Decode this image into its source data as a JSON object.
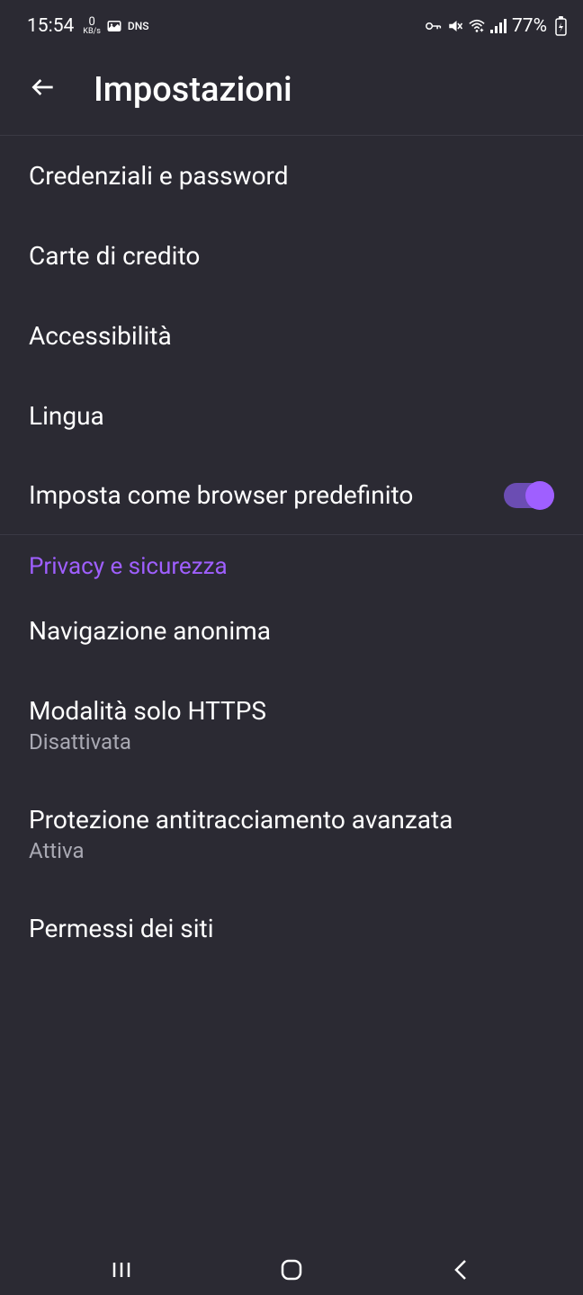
{
  "statusBar": {
    "time": "15:54",
    "speedNum": "0",
    "speedUnit": "KB/s",
    "dns": "DNS",
    "battery": "77%"
  },
  "header": {
    "title": "Impostazioni"
  },
  "settings": {
    "credentials": "Credenziali e password",
    "cards": "Carte di credito",
    "accessibility": "Accessibilità",
    "language": "Lingua",
    "defaultBrowser": "Imposta come browser predefinito"
  },
  "privacy": {
    "sectionTitle": "Privacy e sicurezza",
    "privateBrowsing": "Navigazione anonima",
    "httpsOnly": "Modalità solo HTTPS",
    "httpsOnlyStatus": "Disattivata",
    "tracking": "Protezione antitracciamento avanzata",
    "trackingStatus": "Attiva",
    "sitePermissions": "Permessi dei siti"
  }
}
